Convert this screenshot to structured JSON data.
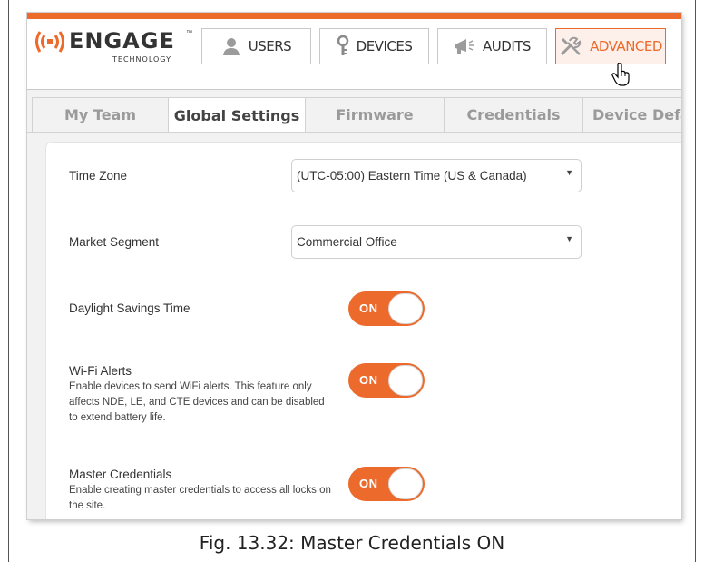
{
  "brand": {
    "name": "ENGAGE",
    "tagline": "TECHNOLOGY",
    "trademark": "™",
    "accent": "#ec6a2c"
  },
  "nav": [
    {
      "label": "USERS",
      "icon": "user-icon",
      "active": false
    },
    {
      "label": "DEVICES",
      "icon": "key-icon",
      "active": false
    },
    {
      "label": "AUDITS",
      "icon": "megaphone-icon",
      "active": false
    },
    {
      "label": "ADVANCED",
      "icon": "tools-icon",
      "active": true
    }
  ],
  "tabs": [
    {
      "label": "My Team",
      "active": false
    },
    {
      "label": "Global Settings",
      "active": true
    },
    {
      "label": "Firmware",
      "active": false
    },
    {
      "label": "Credentials",
      "active": false
    },
    {
      "label": "Device Defa",
      "active": false
    }
  ],
  "settings": {
    "time_zone": {
      "label": "Time Zone",
      "value": "(UTC-05:00) Eastern Time (US & Canada)"
    },
    "market_segment": {
      "label": "Market Segment",
      "value": "Commercial Office"
    },
    "daylight_savings": {
      "label": "Daylight Savings Time",
      "state": "ON"
    },
    "wifi_alerts": {
      "label": "Wi-Fi Alerts",
      "description": "Enable devices to send WiFi alerts. This feature only affects NDE, LE, and CTE devices and can be disabled to extend battery life.",
      "state": "ON"
    },
    "master_credentials": {
      "label": "Master Credentials",
      "description": "Enable creating master credentials to access all locks on the site.",
      "state": "ON"
    }
  },
  "caption": "Fig. 13.32: Master Credentials ON"
}
